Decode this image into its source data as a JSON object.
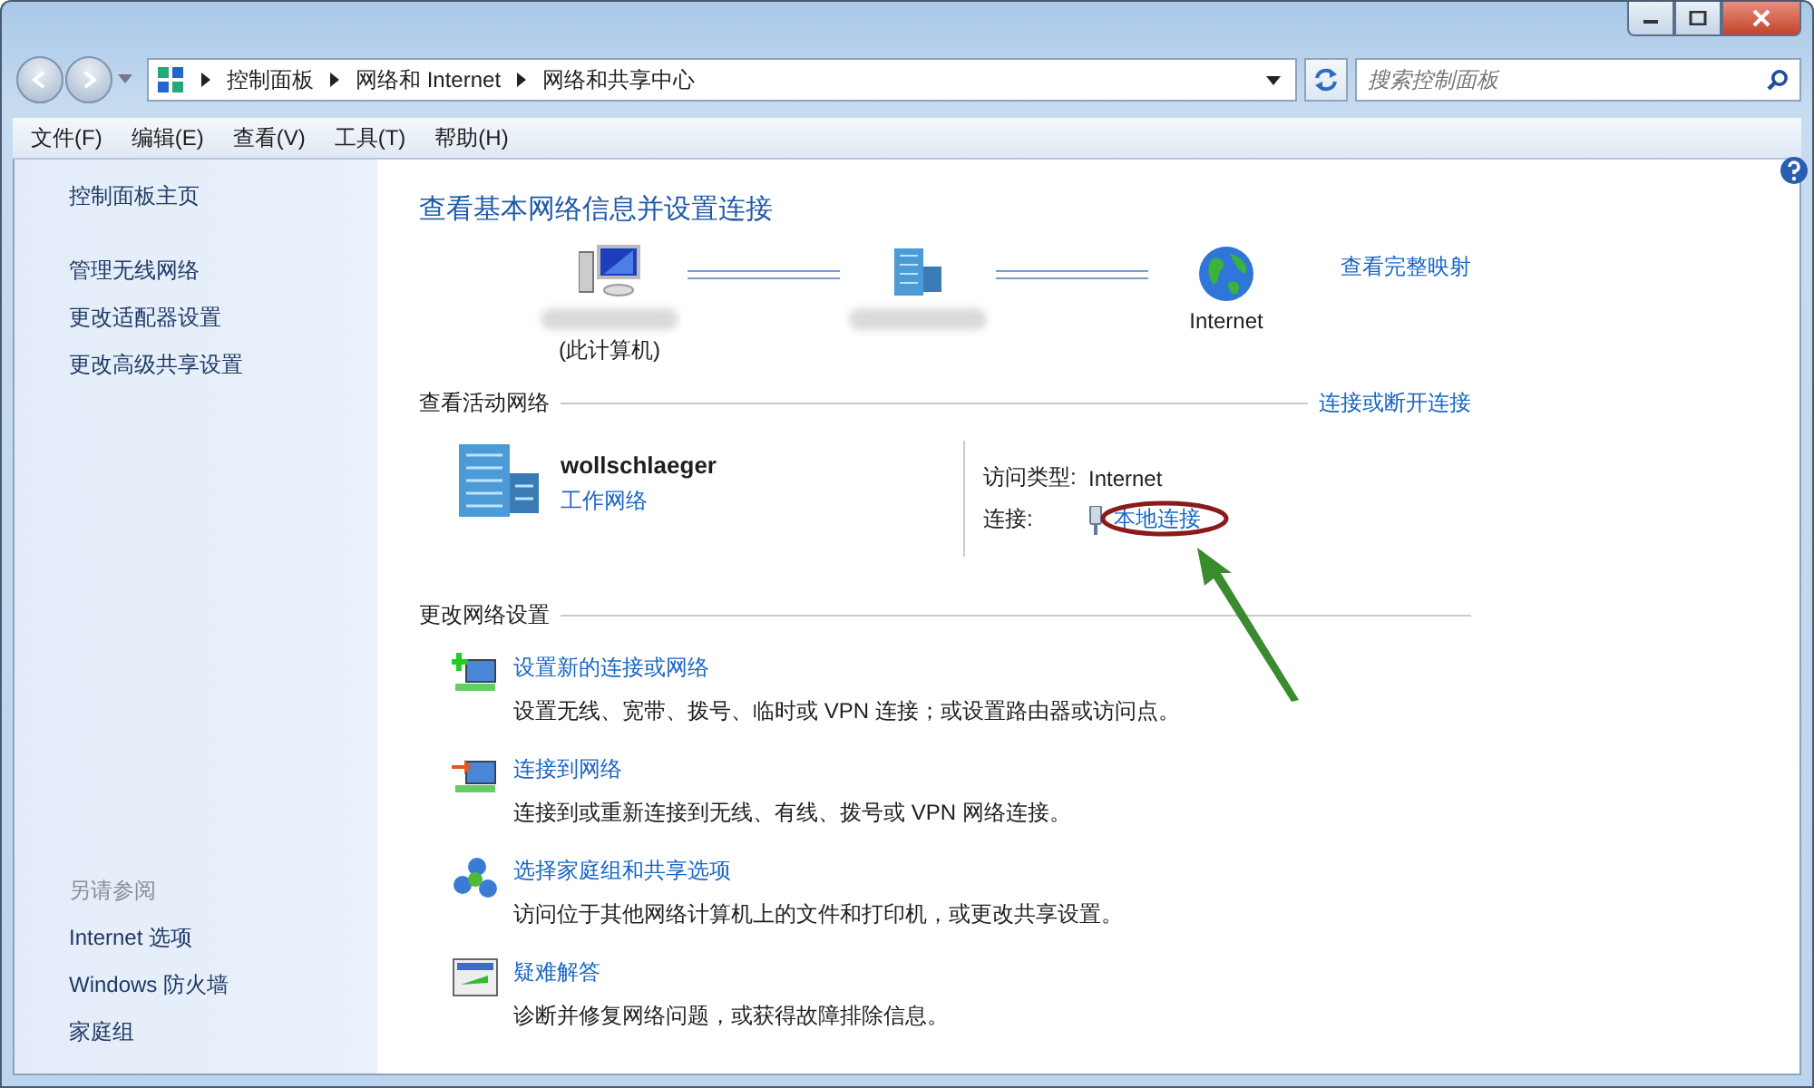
{
  "address_bar": {
    "breadcrumbs": [
      "控制面板",
      "网络和 Internet",
      "网络和共享中心"
    ]
  },
  "search": {
    "placeholder": "搜索控制面板"
  },
  "menu": [
    "文件(F)",
    "编辑(E)",
    "查看(V)",
    "工具(T)",
    "帮助(H)"
  ],
  "sidebar": {
    "items": [
      "控制面板主页",
      "管理无线网络",
      "更改适配器设置",
      "更改高级共享设置"
    ],
    "see_also_title": "另请参阅",
    "see_also": [
      "Internet 选项",
      "Windows 防火墙",
      "家庭组"
    ]
  },
  "main": {
    "title": "查看基本网络信息并设置连接",
    "map_link": "查看完整映射",
    "nodes": [
      {
        "kind": "computer",
        "blurred": true,
        "label": "(此计算机)"
      },
      {
        "kind": "network",
        "blurred": true
      },
      {
        "kind": "globe",
        "blurred": false,
        "label": "Internet"
      }
    ]
  },
  "active_networks": {
    "heading": "查看活动网络",
    "link": "连接或断开连接",
    "name": "wollschlaeger",
    "type": "工作网络",
    "access_label": "访问类型:",
    "access_value": "Internet",
    "connection_label": "连接:",
    "connection_value": "本地连接"
  },
  "change_settings": {
    "heading": "更改网络设置",
    "tasks": [
      {
        "kind": "new",
        "title": "设置新的连接或网络",
        "description": "设置无线、宽带、拨号、临时或 VPN 连接；或设置路由器或访问点。"
      },
      {
        "kind": "connect",
        "title": "连接到网络",
        "description": "连接到或重新连接到无线、有线、拨号或 VPN 网络连接。"
      },
      {
        "kind": "homegroup",
        "title": "选择家庭组和共享选项",
        "description": "访问位于其他网络计算机上的文件和打印机，或更改共享设置。"
      },
      {
        "kind": "troubleshoot",
        "title": "疑难解答",
        "description": "诊断并修复网络问题，或获得故障排除信息。"
      }
    ]
  }
}
